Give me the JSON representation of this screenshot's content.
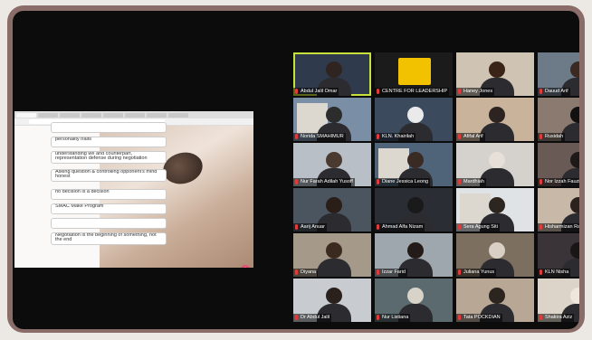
{
  "shared_screen": {
    "answers": [
      "",
      "personality traits",
      "understanding we and counterpart, representation defense during negotiation",
      "Asking question & controlling opponent's mind honest",
      "no decision is a decision",
      "SMAC Make Program",
      "",
      "Negotiation is the beginning of something, not the end"
    ],
    "action_button": "+"
  },
  "participants": [
    {
      "name": "Abdul Jalil Omar",
      "speaking": true
    },
    {
      "name": "CENTRE FOR LEADERSHIP",
      "speaking": false
    },
    {
      "name": "Haney Jones",
      "speaking": false
    },
    {
      "name": "Dauud Arif",
      "speaking": false
    },
    {
      "name": "Norida SMAHIMUR",
      "speaking": false
    },
    {
      "name": "KLN. Khairilah",
      "speaking": false
    },
    {
      "name": "Afifal Arif",
      "speaking": false
    },
    {
      "name": "Rusidah",
      "speaking": false
    },
    {
      "name": "Nur Farah Adilah Yusoff",
      "speaking": false
    },
    {
      "name": "Diane Jessica Leong",
      "speaking": false
    },
    {
      "name": "Mardhiah",
      "speaking": false
    },
    {
      "name": "Nor Izzah Fauzi",
      "speaking": false
    },
    {
      "name": "Aarij Anuar",
      "speaking": false
    },
    {
      "name": "Ahmad Alfa Nizam",
      "speaking": false
    },
    {
      "name": "Sera Agung Siti",
      "speaking": false
    },
    {
      "name": "Hisharmizan Rao",
      "speaking": false
    },
    {
      "name": "Diyana",
      "speaking": false
    },
    {
      "name": "Izzar Farid",
      "speaking": false
    },
    {
      "name": "Juliana Yunus",
      "speaking": false
    },
    {
      "name": "KLN Nisha",
      "speaking": false
    },
    {
      "name": "Dr Abdul Jalil",
      "speaking": false
    },
    {
      "name": "Nur Listiana",
      "speaking": false
    },
    {
      "name": "Tata POCKDIAN",
      "speaking": false
    },
    {
      "name": "Shakira Aziz",
      "speaking": false
    }
  ],
  "colors": {
    "frame": "#8a6c68",
    "screen": "#0c0c0c",
    "speaking_outline": "#c7e03a",
    "mic_muted": "#e33b3b"
  }
}
